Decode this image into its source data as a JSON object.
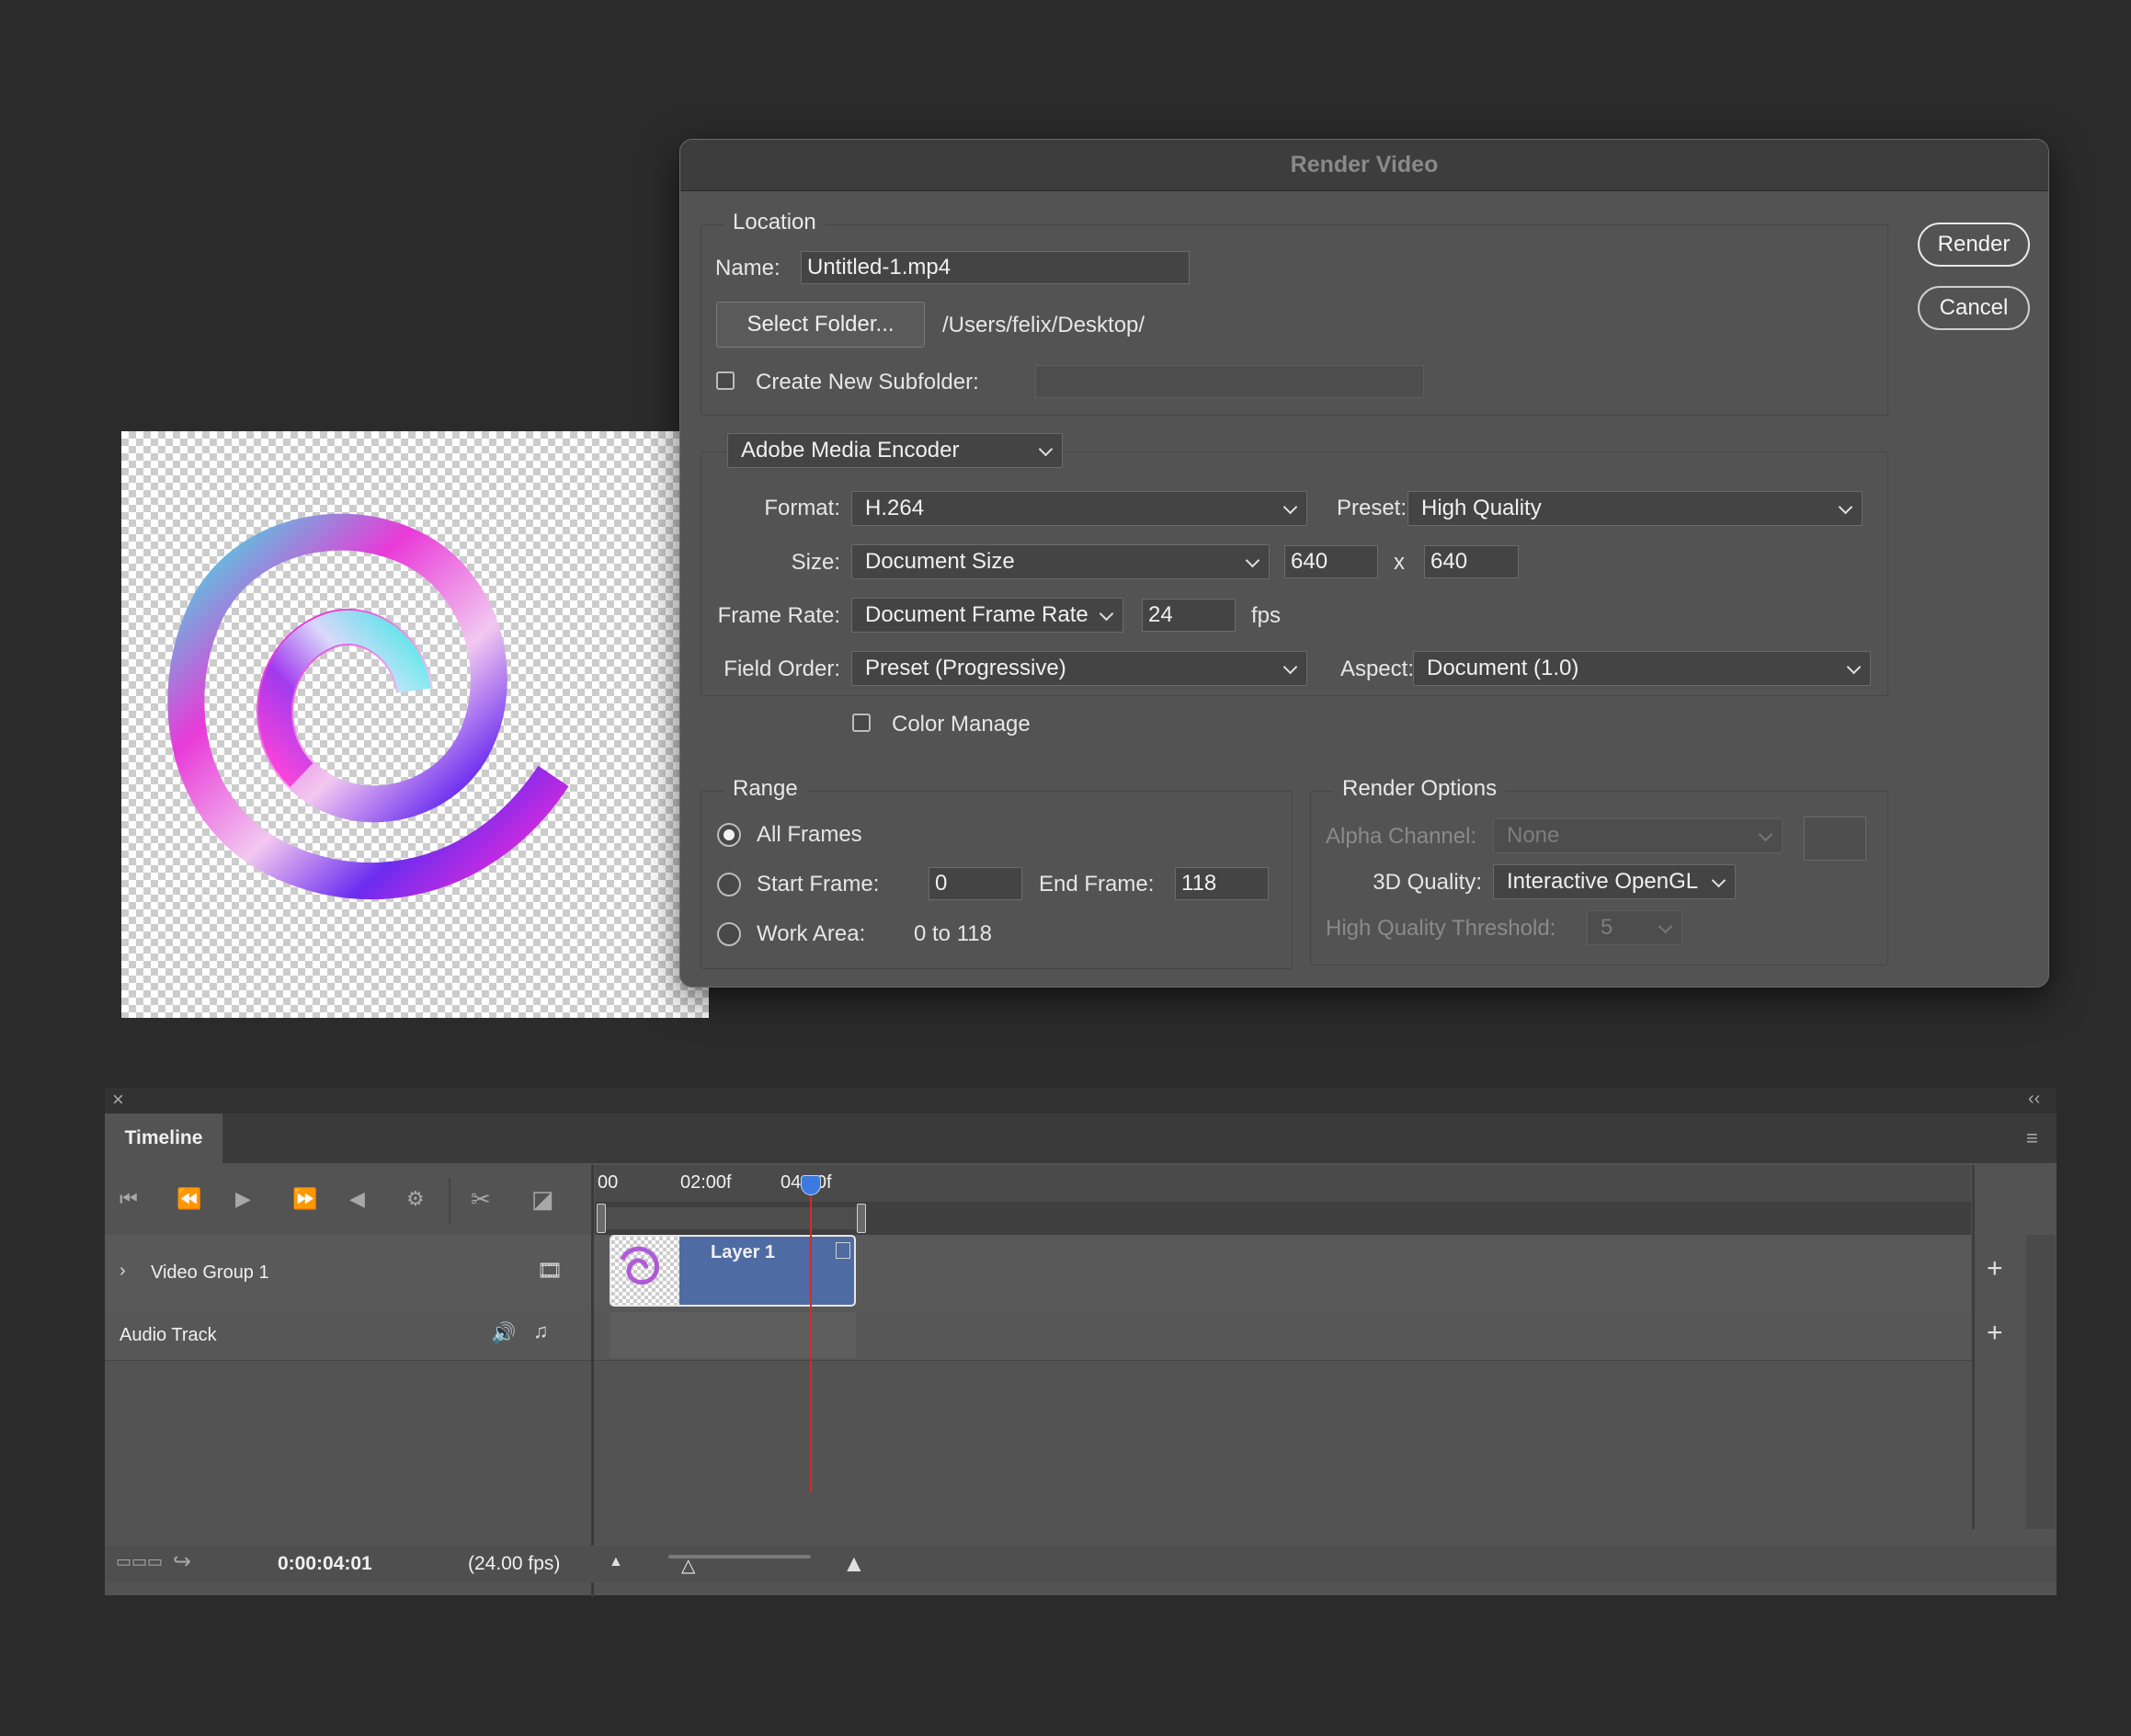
{
  "dialog": {
    "title": "Render Video",
    "buttons": {
      "render": "Render",
      "cancel": "Cancel"
    },
    "location": {
      "legend": "Location",
      "name_label": "Name:",
      "name_value": "Untitled-1.mp4",
      "select_folder_label": "Select Folder...",
      "folder_path": "/Users/felix/Desktop/",
      "subfolder_label": "Create New Subfolder:",
      "subfolder_checked": false,
      "subfolder_value": ""
    },
    "encoder": {
      "encoder_value": "Adobe Media Encoder",
      "format_label": "Format:",
      "format_value": "H.264",
      "preset_label": "Preset:",
      "preset_value": "High Quality",
      "size_label": "Size:",
      "size_value": "Document Size",
      "width_value": "640",
      "x_label": "x",
      "height_value": "640",
      "frame_rate_label": "Frame Rate:",
      "frame_rate_value": "Document Frame Rate",
      "fps_value": "24",
      "fps_label": "fps",
      "field_order_label": "Field Order:",
      "field_order_value": "Preset (Progressive)",
      "aspect_label": "Aspect:",
      "aspect_value": "Document (1.0)",
      "color_manage_label": "Color Manage",
      "color_manage_checked": false
    },
    "range": {
      "legend": "Range",
      "all_frames_label": "All Frames",
      "start_frame_label": "Start Frame:",
      "start_frame_value": "0",
      "end_frame_label": "End Frame:",
      "end_frame_value": "118",
      "work_area_label": "Work Area:",
      "work_area_value": "0 to 118",
      "selected": "all_frames"
    },
    "render_options": {
      "legend": "Render Options",
      "alpha_label": "Alpha Channel:",
      "alpha_value": "None",
      "quality_label": "3D Quality:",
      "quality_value": "Interactive OpenGL",
      "threshold_label": "High Quality Threshold:",
      "threshold_value": "5"
    }
  },
  "timeline": {
    "tab_label": "Timeline",
    "ruler_labels": [
      "00",
      "02:00f",
      "04:00f"
    ],
    "tracks": {
      "video_group_label": "Video Group 1",
      "clip_label": "Layer 1",
      "audio_label": "Audio Track"
    },
    "status": {
      "timecode": "0:00:04:01",
      "frame_rate": "(24.00 fps)"
    }
  },
  "icons": {
    "close": "close-icon",
    "collapse": "collapse-panel-icon",
    "panel_menu": "panel-menu-icon",
    "transport": [
      "go-to-first-frame-icon",
      "previous-frame-icon",
      "play-icon",
      "next-frame-icon",
      "mute-audio-icon",
      "settings-gear-icon",
      "split-scissors-icon",
      "transition-icon"
    ]
  },
  "colors": {
    "dialog_bg": "#535353",
    "clip_blue": "#4f6ba3",
    "playhead": "#d22b2b"
  }
}
